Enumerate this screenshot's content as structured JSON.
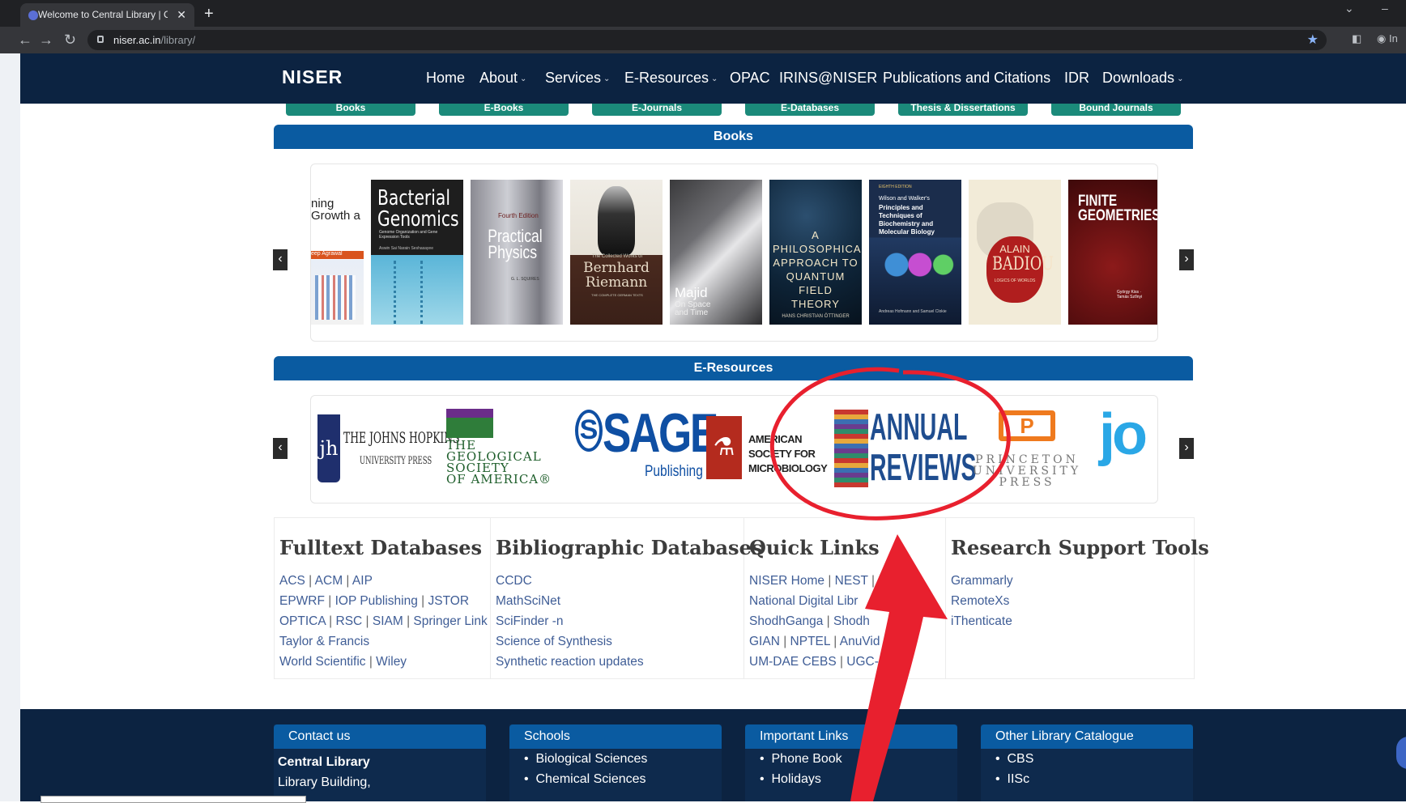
{
  "browser": {
    "tab_title": "Welcome to Central Library | Cen",
    "tab_close": "✕",
    "new_tab": "+",
    "url_host": "niser.ac.in",
    "url_path": "/library/",
    "profile_label": "In"
  },
  "header": {
    "logo": "NISER",
    "nav": [
      {
        "label": "Home"
      },
      {
        "label": "About"
      },
      {
        "label": "Services"
      },
      {
        "label": "E-Resources"
      },
      {
        "label": "OPAC"
      },
      {
        "label": "IRINS@NISER"
      },
      {
        "label": "Publications and Citations"
      },
      {
        "label": "IDR"
      },
      {
        "label": "Downloads"
      }
    ]
  },
  "resource_tabs": [
    "Books",
    "E-Books",
    "E-Journals",
    "E-Databases",
    "Thesis & Dissertations",
    "Bound Journals"
  ],
  "books_section": {
    "title": "Books",
    "prev": "‹",
    "next": "›",
    "covers": [
      {
        "title": "ning Growth a",
        "author": "eep Agrawal"
      },
      {
        "title": "Bacterial Genomics",
        "subtitle": "Genome Organization and Gene Expression Tools",
        "author": "Aswin Sai Narain Seshasayee"
      },
      {
        "title": "Practical Physics",
        "edition": "Fourth Edition",
        "author": "G. L. SQUIRES"
      },
      {
        "title": "Bernhard Riemann",
        "subtitle": "The Collected Works of",
        "tagline": "THE COMPLETE GERMAN TEXTS"
      },
      {
        "title": "Majid",
        "subtitle": "On Space and Time"
      },
      {
        "title": "A PHILOSOPHICAL APPROACH TO QUANTUM FIELD THEORY",
        "author": "HANS CHRISTIAN ÖTTINGER"
      },
      {
        "title": "Principles and Techniques of Biochemistry and Molecular Biology",
        "subtitle": "Wilson and Walker's",
        "edition": "EIGHTH EDITION",
        "author": "Andreas Hofmann and Samuel Clokie"
      },
      {
        "title": "BADIOU",
        "author": "ALAIN",
        "subtitle": "LOGICS OF WORLDS"
      },
      {
        "title": "FINITE GEOMETRIES",
        "author": "György Kiss · Tamás Szőnyi"
      }
    ]
  },
  "eresources_section": {
    "title": "E-Resources",
    "prev": "‹",
    "next": "›",
    "logos": [
      {
        "name": "THE JOHNS HOPKINS UNIVERSITY PRESS",
        "line1": "THE JOHNS HOPKINS",
        "line2": "UNIVERSITY PRESS",
        "mark": "jh"
      },
      {
        "name": "THE GEOLOGICAL SOCIETY OF AMERICA",
        "line1": "THE",
        "line2": "GEOLOGICAL",
        "line3": "SOCIETY",
        "line4": "OF AMERICA®"
      },
      {
        "name": "SAGE Publishing",
        "line1": "SAGE",
        "line2": "Publishing"
      },
      {
        "name": "AMERICAN SOCIETY FOR MICROBIOLOGY",
        "line1": "AMERICAN",
        "line2": "SOCIETY FOR",
        "line3": "MICROBIOLOGY"
      },
      {
        "name": "ANNUAL REVIEWS",
        "line1": "ANNUAL",
        "line2": "REVIEWS"
      },
      {
        "name": "PRINCETON UNIVERSITY PRESS",
        "line1": "PRINCETON",
        "line2": "UNIVERSITY",
        "line3": "PRESS"
      },
      {
        "name": "JoVE",
        "line1": "jo"
      }
    ]
  },
  "link_columns": [
    {
      "title": "Fulltext Databases",
      "lines": [
        [
          "ACS",
          "ACM",
          "AIP"
        ],
        [
          "EPWRF",
          "IOP Publishing",
          "JSTOR"
        ],
        [
          "OPTICA",
          "RSC",
          "SIAM",
          "Springer Link"
        ],
        [
          "Taylor & Francis"
        ],
        [
          "World Scientific",
          "Wiley"
        ]
      ]
    },
    {
      "title": "Bibliographic Databases",
      "lines": [
        [
          "CCDC"
        ],
        [
          "MathSciNet"
        ],
        [
          "SciFinder -n"
        ],
        [
          "Science of Synthesis"
        ],
        [
          "Synthetic reaction updates"
        ]
      ]
    },
    {
      "title": "Quick Links",
      "lines": [
        [
          "NISER Home",
          "NEST",
          "I"
        ],
        [
          "National Digital Libr"
        ],
        [
          "ShodhGanga",
          "Shodh"
        ],
        [
          "GIAN",
          "NPTEL",
          "AnuVid"
        ],
        [
          "UM-DAE CEBS",
          "UGC-C"
        ]
      ]
    },
    {
      "title": "Research Support Tools",
      "lines": [
        [
          "Grammarly"
        ],
        [
          "RemoteXs"
        ],
        [
          "iThenticate"
        ]
      ]
    }
  ],
  "footer": {
    "boxes": [
      {
        "title": "Contact us",
        "items": [
          "Central Library",
          "Library Building,"
        ]
      },
      {
        "title": "Schools",
        "items": [
          "Biological Sciences",
          "Chemical Sciences"
        ]
      },
      {
        "title": "Important Links",
        "items": [
          "Phone Book",
          "Holidays"
        ]
      },
      {
        "title": "Other Library Catalogue",
        "items": [
          "CBS",
          "IISc"
        ]
      }
    ]
  },
  "annotation": {
    "circle_color": "#e8202e",
    "arrow_color": "#e8202e"
  },
  "colors": {
    "header_bg": "#0c2341",
    "section_bar": "#0a5ba1",
    "tab_green": "#1b8a7a",
    "link": "#3f5d96"
  }
}
